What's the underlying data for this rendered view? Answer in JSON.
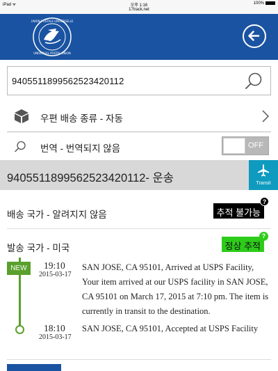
{
  "statusbar": {
    "device": "iPad ᯤ",
    "time": "오후 1:16",
    "battery": "100%"
  },
  "urlbar": {
    "url": "17track.net"
  },
  "header": {
    "logo": "upu-logo",
    "back_icon": "back-arrow-circle-icon",
    "color": "#1a53a1"
  },
  "search": {
    "value": "9405511899562523420112",
    "icon": "search-icon"
  },
  "carrier_row": {
    "icon": "package-box-icon",
    "label": "우편 배송 종류 - 자동",
    "chevron": "chevron-right-icon"
  },
  "translate_row": {
    "icon": "search-icon",
    "label": "번역 - 번역되지 않음",
    "toggle_state": "OFF"
  },
  "status": {
    "title": "9405511899562523420112- 운송",
    "badge_icon": "airplane-icon",
    "badge_label": "Transit",
    "badge_color": "#0f9bbf"
  },
  "destination": {
    "label": "배송 국가 - 알려지지 않음",
    "badge": "추적 불가능",
    "help": "?"
  },
  "origin": {
    "label": "발송 국가 - 미국",
    "badge": "정상 추적",
    "help": "?"
  },
  "events": [
    {
      "tag": "NEW",
      "time": "19:10",
      "date": "2015-03-17",
      "desc": "SAN JOSE, CA 95101, Arrived at USPS Facility, Your item arrived at our USPS facility in SAN JOSE, CA 95101 on March 17, 2015 at 7:10 pm. The item is currently in transit to the destination."
    },
    {
      "time": "18:10",
      "date": "2015-03-17",
      "desc": "SAN JOSE, CA 95101, Accepted at USPS Facility"
    }
  ]
}
